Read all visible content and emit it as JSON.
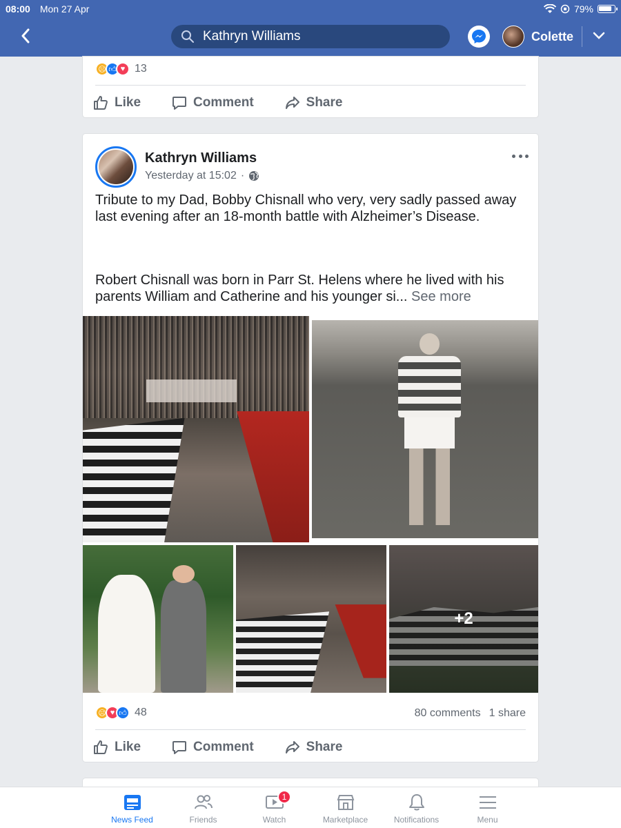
{
  "status_bar": {
    "time": "08:00",
    "date": "Mon 27 Apr",
    "battery": "79%"
  },
  "header": {
    "search_query": "Kathryn Williams",
    "user_name": "Colette",
    "brand_color": "#4267b2"
  },
  "previous_post": {
    "reaction_count": "13",
    "actions": {
      "like": "Like",
      "comment": "Comment",
      "share": "Share"
    }
  },
  "post": {
    "author": "Kathryn Williams",
    "timestamp": "Yesterday at 15:02",
    "separator": "·",
    "paragraph1": "Tribute to my Dad, Bobby Chisnall who very, very sadly passed away last evening after an 18-month battle with Alzheimer’s Disease.",
    "paragraph2": "Robert Chisnall was born in Parr St. Helens where he lived with his parents William and Catherine and his younger si...",
    "see_more": "See more",
    "more_photos": "+2",
    "reaction_count": "48",
    "comments": "80 comments",
    "shares": "1 share",
    "actions": {
      "like": "Like",
      "comment": "Comment",
      "share": "Share"
    }
  },
  "tabbar": {
    "news_feed": "News Feed",
    "friends": "Friends",
    "watch": "Watch",
    "watch_badge": "1",
    "marketplace": "Marketplace",
    "notifications": "Notifications",
    "menu": "Menu"
  }
}
